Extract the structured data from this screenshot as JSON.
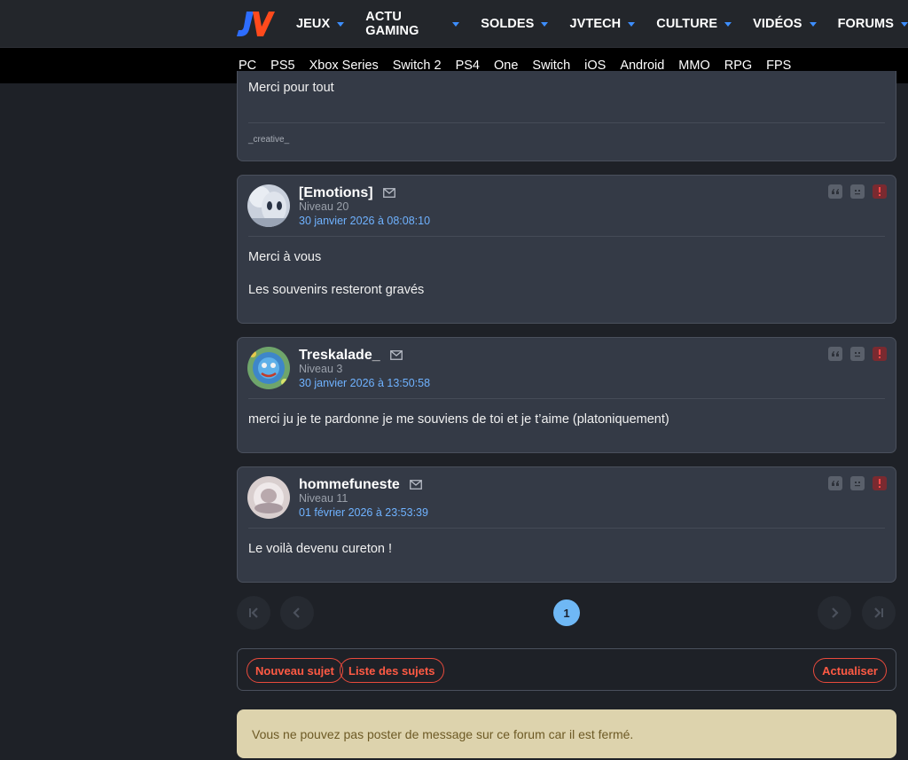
{
  "nav": {
    "items": [
      {
        "label": "JEUX"
      },
      {
        "label": "ACTU GAMING"
      },
      {
        "label": "SOLDES"
      },
      {
        "label": "JVTECH"
      },
      {
        "label": "CULTURE"
      },
      {
        "label": "VIDÉOS"
      },
      {
        "label": "FORUMS"
      }
    ]
  },
  "subnav": {
    "items": [
      "PC",
      "PS5",
      "Xbox Series",
      "Switch 2",
      "PS4",
      "One",
      "Switch",
      "iOS",
      "Android",
      "MMO",
      "RPG",
      "FPS"
    ]
  },
  "partial_post": {
    "text": "Merci pour tout",
    "signature": "_creative_"
  },
  "posts": [
    {
      "author": "[Emotions]",
      "level": "Niveau 20",
      "date": "30 janvier 2026 à 08:08:10",
      "lines": [
        "Merci à vous",
        "Les souvenirs resteront gravés"
      ]
    },
    {
      "author": "Treskalade_",
      "level": "Niveau 3",
      "date": "30 janvier 2026 à 13:50:58",
      "lines": [
        "merci ju je te pardonne je me souviens de toi et je t’aime (platoniquement)"
      ]
    },
    {
      "author": "hommefuneste",
      "level": "Niveau 11",
      "date": "01 février 2026 à 23:53:39",
      "lines": [
        "Le voilà devenu cureton !"
      ]
    }
  ],
  "pagination": {
    "current": "1"
  },
  "actions": {
    "new_topic": "Nouveau sujet",
    "topic_list": "Liste des sujets",
    "refresh": "Actualiser"
  },
  "notice": "Vous ne pouvez pas poster de message sur ce forum car il est fermé.",
  "colors": {
    "accent_blue": "#3d8eff",
    "date_blue": "#6fb2ff",
    "button_red": "#ff5a44",
    "notice_bg": "#ddd3ad"
  }
}
